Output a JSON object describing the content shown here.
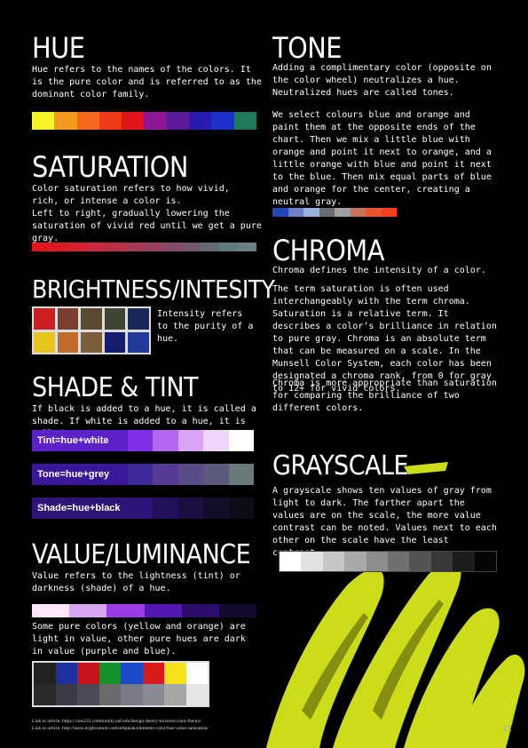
{
  "hue": {
    "title": "Hue",
    "text": "Hue refers to the names of the colors. It is the pure color and is referred to as the dominant color family.",
    "colors": [
      "#f5f52a",
      "#f59a1e",
      "#f3661c",
      "#ef3a18",
      "#e0161a",
      "#8e1796",
      "#5a1a9a",
      "#2a1ab0",
      "#1a30c8",
      "#1f7a5a"
    ]
  },
  "saturation": {
    "title": "Saturation",
    "text1": "Color saturation refers to how vivid, rich, or intense a color is.",
    "text2": "Left to right, gradually lowering the saturation of vivid red until we get a pure gray.",
    "colors": [
      "#e3141a",
      "#dd1a22",
      "#d42030",
      "#c8273c",
      "#b92f48",
      "#a83a55",
      "#973e5f",
      "#844b68",
      "#735770",
      "#646a74",
      "#5e7a7a",
      "#6b8080"
    ]
  },
  "brightness": {
    "title": "Brightness/Intesity",
    "text": "Intensity refers to the purity of a hue.",
    "colors": [
      "#cc1f22",
      "#7a3f2e",
      "#5a4a32",
      "#3d4431",
      "#1a2858",
      "#e6c41e",
      "#c06a2c",
      "#7a5e3a",
      "#151e6e",
      "#223a9a"
    ]
  },
  "shade": {
    "title": "Shade & Tint",
    "text": "If black is added to a hue, it is called a shade. If white is added to a hue, it is called a tint.",
    "tint": {
      "label": "Tint=hue+white",
      "colors": [
        "#7f2fe6",
        "#b566f0",
        "#d9a5f4",
        "#eed6f8",
        "#ffffff"
      ]
    },
    "tone": {
      "label": "Tone=hue+grey",
      "colors": [
        "#3e2898",
        "#543a92",
        "#5a4a86",
        "#5a5a7a",
        "#6a7a7a"
      ]
    },
    "shadeband": {
      "label": "Shade=hue+black",
      "colors": [
        "#2e1478",
        "#23105a",
        "#1a0e3e",
        "#130c28",
        "#0e0c18"
      ]
    }
  },
  "value": {
    "title": "Value/Luminance",
    "text1": "Value refers to the lightness (tint) or darkness (shade) of a hue.",
    "text2": "Some pure colors (yellow and orange) are light in value, other pure hues are dark in value (purple and blue).",
    "colors": [
      "#fbe6fb",
      "#d7a6f2",
      "#9b3ce8",
      "#5018b0",
      "#2a0e6a",
      "#140a30"
    ],
    "photo_top": [
      "#222",
      "#1e2fa0",
      "#c8141a",
      "#16922a",
      "#1a4ac8",
      "#d81a1a",
      "#f5e21a",
      "#ffffff"
    ],
    "photo_bottom": [
      "#2a2a2a",
      "#3a3a48",
      "#4a4a58",
      "#6a6a6a",
      "#7a7a88",
      "#8a8a94",
      "#a6a6a6",
      "#e6e6e6"
    ]
  },
  "tone": {
    "title": "Tone",
    "text1": "Adding a complimentary color (opposite on the color wheel) neutralizes a hue. Neutralized hues are called tones.",
    "text2": "We select colours blue and orange and paint them at the opposite ends of the chart. Then we mix a little blue with orange and point it next to orange, and a little orange with blue and point it next to the blue. Then mix equal parts of blue and orange for the center, creating a neutral gray.",
    "colors": [
      "#2445b8",
      "#6f80c8",
      "#9ab0dc",
      "#6a6a72",
      "#a0a0a0",
      "#c4725a",
      "#e8552a",
      "#f3401c"
    ]
  },
  "chroma": {
    "title": "Chroma",
    "text1": "Chroma defines the intensity of a color.",
    "text2": "The term saturation is often used interchangeably with the term chroma. Saturation is a relative term. It describes a color’s brilliance in relation to pure gray. Chroma is an absolute term that can be measured on a scale. In the Munsell Color System, each color has been designated a chroma rank, from 0 for gray to 12+ for vivid colors.",
    "text3": "Chroma is more appropriate than saturation for comparing the brilliance of two different colors."
  },
  "grayscale": {
    "title": "Grayscale",
    "text": "A grayscale shows ten values of gray from light to dark. The farther apart the values are on the scale, the more value contrast can be noted. Values next to each other on the scale have the least contrast.",
    "colors": [
      "#ffffff",
      "#e2e2e2",
      "#c6c6c6",
      "#a9a9a9",
      "#8c8c8c",
      "#707070",
      "#545454",
      "#383838",
      "#1c1c1c",
      "#050505"
    ]
  },
  "links": [
    "Link to article: https://cios233.community.uaf.edu/design-theory-lectures/color-theory/",
    "Link to article: http://learn.leighcotnoir.com/artspeak/elements-color/hue-value-saturation/"
  ],
  "page_number": "21",
  "accent": "#d8e81a"
}
